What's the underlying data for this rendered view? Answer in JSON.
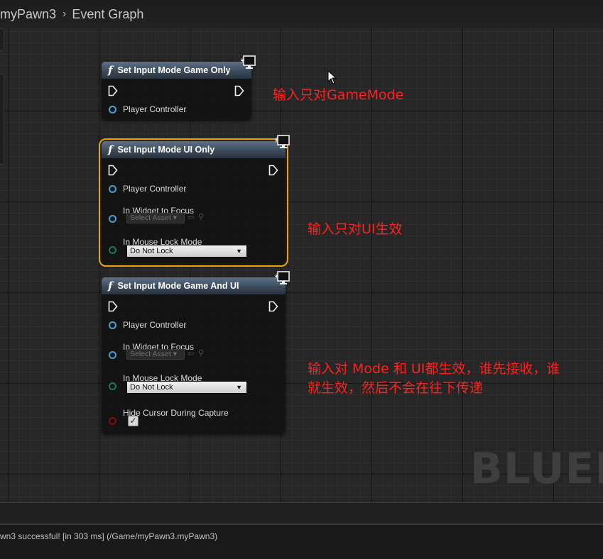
{
  "breadcrumb": {
    "items": [
      "myPawn3",
      "Event Graph"
    ],
    "separator": "›"
  },
  "nodes": [
    {
      "title": "Set Input Mode Game Only",
      "icon": "function-icon",
      "pins": {
        "player_controller": "Player Controller"
      }
    },
    {
      "title": "Set Input Mode UI Only",
      "icon": "function-icon",
      "selected": true,
      "pins": {
        "player_controller": "Player Controller",
        "widget_to_focus": "In Widget to Focus",
        "widget_asset": "Select Asset",
        "mouse_lock": "In Mouse Lock Mode",
        "mouse_lock_value": "Do Not Lock"
      }
    },
    {
      "title": "Set Input Mode Game And UI",
      "icon": "function-icon",
      "pins": {
        "player_controller": "Player Controller",
        "widget_to_focus": "In Widget to Focus",
        "widget_asset": "Select Asset",
        "mouse_lock": "In Mouse Lock Mode",
        "mouse_lock_value": "Do Not Lock",
        "hide_cursor": "Hide Cursor During Capture",
        "hide_cursor_checked": true
      }
    }
  ],
  "annotations": {
    "game_only": "输入只对GameMode",
    "ui_only": "输入只对UI生效",
    "game_and_ui_line1": "输入对 Mode 和 UI都生效，谁先接收，谁",
    "game_and_ui_line2": "就生效，然后不会在往下传递"
  },
  "watermark": "BLUEPR",
  "status_log": "wn3 successful! [in 303 ms] (/Game/myPawn3.myPawn3)",
  "colors": {
    "annotation": "#ff2020",
    "selection_outline": "#e8a30c",
    "object_pin": "#3fa3d8",
    "enum_pin": "#0f7a68",
    "bool_pin": "#7d0e0e",
    "node_header": "#4a5b6c"
  }
}
